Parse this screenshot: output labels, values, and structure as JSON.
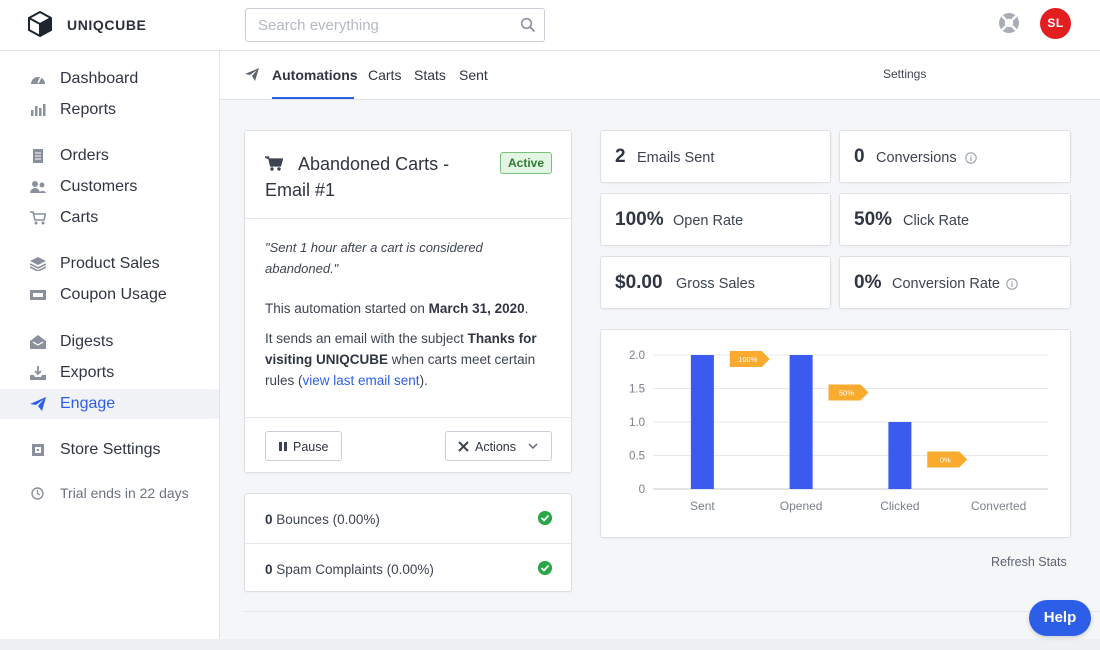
{
  "app": {
    "brand": "UNIQCUBE"
  },
  "search": {
    "placeholder": "Search everything"
  },
  "user": {
    "initials": "SL"
  },
  "sidebar": {
    "items": [
      {
        "label": "Dashboard",
        "icon": "speedometer-icon"
      },
      {
        "label": "Reports",
        "icon": "bar-chart-icon"
      },
      {
        "label": "Orders",
        "icon": "receipt-icon"
      },
      {
        "label": "Customers",
        "icon": "users-icon"
      },
      {
        "label": "Carts",
        "icon": "cart-icon"
      },
      {
        "label": "Product Sales",
        "icon": "stack-icon"
      },
      {
        "label": "Coupon Usage",
        "icon": "ticket-icon"
      },
      {
        "label": "Digests",
        "icon": "inbox-icon"
      },
      {
        "label": "Exports",
        "icon": "download-icon"
      },
      {
        "label": "Engage",
        "icon": "paper-plane-icon",
        "active": true
      },
      {
        "label": "Store Settings",
        "icon": "settings-icon"
      }
    ],
    "trial": "Trial ends in 22 days"
  },
  "subnav": {
    "tabs": [
      "Automations",
      "Carts",
      "Stats",
      "Sent"
    ],
    "active_tab": "Automations",
    "settings": "Settings"
  },
  "automation": {
    "title": "Abandoned Carts - Email #1",
    "status": "Active",
    "quote": "\"Sent 1 hour after a cart is considered abandoned.\"",
    "started_prefix": "This automation started on ",
    "started_date": "March 31, 2020",
    "started_suffix": ".",
    "subject_prefix": "It sends an email with the subject ",
    "subject": "Thanks for visiting UNIQCUBE",
    "subject_mid": " when carts meet certain rules (",
    "view_link": "view last email sent",
    "subject_end": ").",
    "pause_label": "Pause",
    "actions_label": "Actions"
  },
  "deliverability": {
    "bounces_count": "0",
    "bounces_label": "Bounces (0.00%)",
    "spam_count": "0",
    "spam_label": "Spam Complaints (0.00%)"
  },
  "stats": {
    "emails_sent": {
      "value": "2",
      "label": "Emails Sent"
    },
    "conversions": {
      "value": "0",
      "label": "Conversions"
    },
    "open_rate": {
      "value": "100%",
      "label": "Open Rate"
    },
    "click_rate": {
      "value": "50%",
      "label": "Click Rate"
    },
    "gross_sales": {
      "value": "$0.00",
      "label": "Gross Sales"
    },
    "conversion_rate": {
      "value": "0%",
      "label": "Conversion Rate"
    }
  },
  "refresh_label": "Refresh Stats",
  "help_label": "Help",
  "colors": {
    "accent": "#2c5ee8",
    "bar": "#3b5bf0",
    "funnel_tag": "#f8ab2e",
    "success": "#28a745",
    "avatar": "#e21e1e"
  },
  "chart_data": {
    "type": "bar",
    "categories": [
      "Sent",
      "Opened",
      "Clicked",
      "Converted"
    ],
    "values": [
      2,
      2,
      1,
      0
    ],
    "conversion_tags": [
      "100%",
      "50%",
      "0%"
    ],
    "ylim": [
      0,
      2
    ],
    "yticks": [
      "0",
      "0.5",
      "1.0",
      "1.5",
      "2.0"
    ],
    "grid": true
  }
}
